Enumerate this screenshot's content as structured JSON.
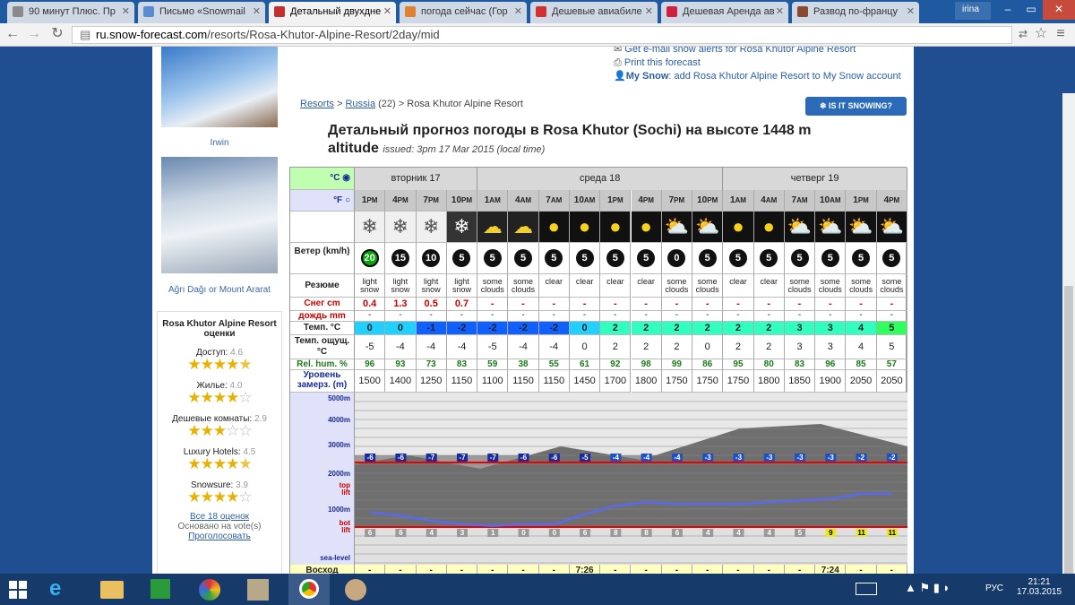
{
  "browser": {
    "tabs": [
      {
        "label": "90 минут Плюс. Пр",
        "color": "#8a8a8a"
      },
      {
        "label": "Письмо «Snowmail",
        "color": "#5a8ad0"
      },
      {
        "label": "Детальный двухдне",
        "color": "#c03030"
      },
      {
        "label": "погода сейчас (Гор",
        "color": "#e08030"
      },
      {
        "label": "Дешевые авиабиле",
        "color": "#d03030"
      },
      {
        "label": "Дешевая Аренда ав",
        "color": "#d02040"
      },
      {
        "label": "Развод по-францу",
        "color": "#8a4a30"
      }
    ],
    "user": "irina",
    "url_domain": "ru.snow-forecast.com",
    "url_path": "/resorts/Rosa-Khutor-Alpine-Resort/2day/mid"
  },
  "sidebar": {
    "caption1": "Irwin",
    "caption2": "Ağrı Dağı or Mount Ararat",
    "ratings_title": "Rosa Khutor Alpine Resort оценки",
    "ratings": [
      {
        "label": "Доступ:",
        "score": "4.6",
        "stars": 4.5
      },
      {
        "label": "Жилье:",
        "score": "4.0",
        "stars": 4
      },
      {
        "label": "Дешевые комнаты:",
        "score": "2.9",
        "stars": 3
      },
      {
        "label": "Luxury Hotels:",
        "score": "4.5",
        "stars": 4.5
      },
      {
        "label": "Snowsure:",
        "score": "3.9",
        "stars": 4
      }
    ],
    "all_link": "Все 18 оценок",
    "votes": "Основано на vote(s)",
    "vote_link": "Проголосовать"
  },
  "top_links": {
    "alerts": "Get e-mail snow alerts for Rosa Khutor Alpine Resort",
    "print": "Print this forecast",
    "mysnow_prefix": "My Snow",
    "mysnow": ": add Rosa Khutor Alpine Resort to My Snow account"
  },
  "breadcrumb": {
    "resorts": "Resorts",
    "country": "Russia",
    "count": "(22)",
    "resort": "> Rosa Khutor Alpine Resort"
  },
  "snow_button": "❄ IS IT SNOWING?",
  "title": "Детальный прогноз погоды в Rosa Khutor (Sochi) на высоте 1448 m altitude",
  "issued": "issued: 3pm 17 Mar 2015 (local time)",
  "units": {
    "c": "°C",
    "f": "°F"
  },
  "labels": {
    "wind": "Ветер (km/h)",
    "summary": "Резюме",
    "snow": "Снег cm",
    "rain": "дождь mm",
    "temp": "Темп. °C",
    "feel": "Темп. ощущ. °C",
    "hum": "Rel. hum. %",
    "freeze": "Уровень замерз. (m)",
    "sunrise": "Восход"
  },
  "days": [
    {
      "name": "вторник 17",
      "n": 4
    },
    {
      "name": "среда 18",
      "n": 8
    },
    {
      "name": "четверг 19",
      "n": 6
    }
  ],
  "periods": [
    {
      "hr": "1",
      "ap": "PM",
      "icon": "snow",
      "wind": "20",
      "w_green": true,
      "sum": "light snow",
      "snow": "0.4",
      "rain": "-",
      "t": "0",
      "t_c": "#22d0ff",
      "feel": "-5",
      "hum": "96",
      "frz": "1500",
      "sun": "-"
    },
    {
      "hr": "4",
      "ap": "PM",
      "icon": "snow",
      "wind": "15",
      "sum": "light snow",
      "snow": "1.3",
      "rain": "-",
      "t": "0",
      "t_c": "#22d0ff",
      "feel": "-4",
      "hum": "93",
      "frz": "1400",
      "sun": "-"
    },
    {
      "hr": "7",
      "ap": "PM",
      "icon": "snow",
      "wind": "10",
      "sum": "light snow",
      "snow": "0.5",
      "rain": "-",
      "t": "-1",
      "t_c": "#1060ff",
      "feel": "-4",
      "hum": "73",
      "frz": "1250",
      "sun": "-"
    },
    {
      "hr": "10",
      "ap": "PM",
      "icon": "snow_night",
      "wind": "5",
      "sum": "light snow",
      "snow": "0.7",
      "rain": "-",
      "t": "-2",
      "t_c": "#1060ff",
      "feel": "-4",
      "hum": "83",
      "frz": "1150",
      "sun": "-"
    },
    {
      "hr": "1",
      "ap": "AM",
      "icon": "cloud_night",
      "wind": "5",
      "sum": "some clouds",
      "snow": "-",
      "rain": "-",
      "t": "-2",
      "t_c": "#1060ff",
      "feel": "-5",
      "hum": "59",
      "frz": "1100",
      "sun": "-"
    },
    {
      "hr": "4",
      "ap": "AM",
      "icon": "cloud_night",
      "wind": "5",
      "sum": "some clouds",
      "snow": "-",
      "rain": "-",
      "t": "-2",
      "t_c": "#1060ff",
      "feel": "-4",
      "hum": "38",
      "frz": "1150",
      "sun": "-"
    },
    {
      "hr": "7",
      "ap": "AM",
      "icon": "sun",
      "wind": "5",
      "sum": "clear",
      "snow": "-",
      "rain": "-",
      "t": "-2",
      "t_c": "#1060ff",
      "feel": "-4",
      "hum": "55",
      "frz": "1150",
      "sun": "-"
    },
    {
      "hr": "10",
      "ap": "AM",
      "icon": "sun",
      "wind": "5",
      "sum": "clear",
      "snow": "-",
      "rain": "-",
      "t": "0",
      "t_c": "#22d0ff",
      "feel": "0",
      "hum": "61",
      "frz": "1450",
      "sun": "7:26"
    },
    {
      "hr": "1",
      "ap": "PM",
      "icon": "sun",
      "wind": "5",
      "sum": "clear",
      "snow": "-",
      "rain": "-",
      "t": "2",
      "t_c": "#30ffc0",
      "feel": "2",
      "hum": "92",
      "frz": "1700",
      "sun": "-"
    },
    {
      "hr": "4",
      "ap": "PM",
      "icon": "sun",
      "wind": "5",
      "sum": "clear",
      "snow": "-",
      "rain": "-",
      "t": "2",
      "t_c": "#30ffc0",
      "feel": "2",
      "hum": "98",
      "frz": "1800",
      "sun": "-"
    },
    {
      "hr": "7",
      "ap": "PM",
      "icon": "cloud_sun",
      "wind": "0",
      "sum": "some clouds",
      "snow": "-",
      "rain": "-",
      "t": "2",
      "t_c": "#30ffc0",
      "feel": "2",
      "hum": "99",
      "frz": "1750",
      "sun": "-"
    },
    {
      "hr": "10",
      "ap": "PM",
      "icon": "cloud_sun",
      "wind": "5",
      "sum": "some clouds",
      "snow": "-",
      "rain": "-",
      "t": "2",
      "t_c": "#30ffc0",
      "feel": "0",
      "hum": "86",
      "frz": "1750",
      "sun": "-"
    },
    {
      "hr": "1",
      "ap": "AM",
      "icon": "sun",
      "wind": "5",
      "sum": "clear",
      "snow": "-",
      "rain": "-",
      "t": "2",
      "t_c": "#30ffc0",
      "feel": "2",
      "hum": "95",
      "frz": "1750",
      "sun": "-"
    },
    {
      "hr": "4",
      "ap": "AM",
      "icon": "sun",
      "wind": "5",
      "sum": "clear",
      "snow": "-",
      "rain": "-",
      "t": "2",
      "t_c": "#30ffc0",
      "feel": "2",
      "hum": "80",
      "frz": "1800",
      "sun": "-"
    },
    {
      "hr": "7",
      "ap": "AM",
      "icon": "cloud_sun",
      "wind": "5",
      "sum": "some clouds",
      "snow": "-",
      "rain": "-",
      "t": "3",
      "t_c": "#30ffc0",
      "feel": "3",
      "hum": "83",
      "frz": "1850",
      "sun": "-"
    },
    {
      "hr": "10",
      "ap": "AM",
      "icon": "cloud_sun",
      "wind": "5",
      "sum": "some clouds",
      "snow": "-",
      "rain": "-",
      "t": "3",
      "t_c": "#30ffc0",
      "feel": "3",
      "hum": "96",
      "frz": "1900",
      "sun": "7:24"
    },
    {
      "hr": "1",
      "ap": "PM",
      "icon": "cloud_sun",
      "wind": "5",
      "sum": "some clouds",
      "snow": "-",
      "rain": "-",
      "t": "4",
      "t_c": "#30ffc0",
      "feel": "4",
      "hum": "85",
      "frz": "2050",
      "sun": "-"
    },
    {
      "hr": "4",
      "ap": "PM",
      "icon": "cloud_sun",
      "wind": "5",
      "sum": "some clouds",
      "snow": "-",
      "rain": "-",
      "t": "5",
      "t_c": "#30ff60",
      "feel": "5",
      "hum": "57",
      "frz": "2050",
      "sun": "-"
    }
  ],
  "altitude_labels": [
    "5000m",
    "4000m",
    "3000m",
    "2000m",
    "top lift",
    "1000m",
    "bot lift",
    "sea-level"
  ],
  "top_temps": [
    "-6",
    "-6",
    "-7",
    "-7",
    "-7",
    "-6",
    "-6",
    "-5",
    "-4",
    "-4",
    "-4",
    "-3",
    "-3",
    "-3",
    "-3",
    "-3",
    "-2",
    "-2"
  ],
  "bot_temps": [
    "6",
    "6",
    "4",
    "3",
    "1",
    "0",
    "0",
    "6",
    "8",
    "8",
    "6",
    "4",
    "4",
    "4",
    "5",
    "9",
    "11",
    "11"
  ],
  "taskbar": {
    "lang": "РУС",
    "time": "21:21",
    "date": "17.03.2015"
  }
}
